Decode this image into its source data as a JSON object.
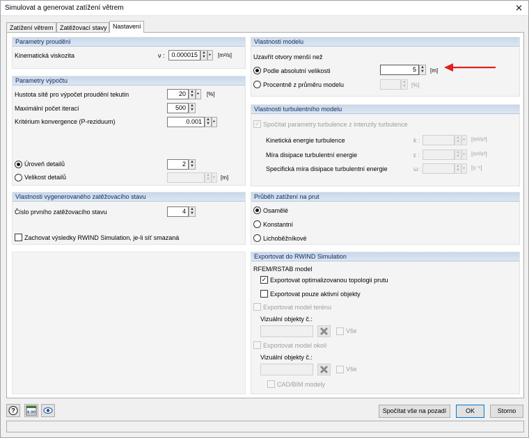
{
  "window": {
    "title": "Simulovat a generovat zatížení větrem",
    "close": "✕"
  },
  "tabs": [
    "Zatížení větrem",
    "Zatěžovací stavy",
    "Nastavení"
  ],
  "flow": {
    "title": "Parametry proudění",
    "viscosity_label": "Kinematická viskozita",
    "viscosity_symbol": "ν :",
    "viscosity_value": "0.000015",
    "viscosity_unit": "[m²/s]"
  },
  "calc": {
    "title": "Parametry výpočtu",
    "mesh_label": "Hustota sítě pro výpočet proudění tekutin",
    "mesh_value": "20",
    "mesh_unit": "[%]",
    "iter_label": "Maximální počet iterací",
    "iter_value": "500",
    "conv_label": "Kritérium konvergence (P-reziduum)",
    "conv_value": "0.001",
    "detail_level_label": "Úroveň detailů",
    "detail_level_value": "2",
    "detail_size_label": "Velikost detailů",
    "detail_size_value": "",
    "detail_size_unit": "[m]"
  },
  "generated": {
    "title": "Vlastnosti vygenerovaného zatěžovacího stavu",
    "first_lc_label": "Číslo prvního zatěžovacího stavu",
    "first_lc_value": "4",
    "keep_results_label": "Zachovat výsledky RWIND Simulation, je-li síť smazaná"
  },
  "model": {
    "title": "Vlastnosti modelu",
    "close_openings_label": "Uzavřít otvory menší než",
    "abs_label": "Podle absolutní velikosti",
    "abs_value": "5",
    "abs_unit": "[m]",
    "pct_label": "Procentně z průměru modelu",
    "pct_value": "",
    "pct_unit": "[%]"
  },
  "turbulence": {
    "title": "Vlastnosti turbulentního modelu",
    "calc_label": "Spočítat parametry turbulence z intenzity turbulence",
    "k_label": "Kinetická energie turbulence",
    "k_symbol": "k :",
    "k_unit": "[m²/s²]",
    "eps_label": "Míra disipace turbulentní energie",
    "eps_symbol": "ε :",
    "eps_unit": "[m²/s³]",
    "omega_label": "Specifická míra disipace turbulentní energie",
    "omega_symbol": "ω :",
    "omega_unit": "[s⁻¹]"
  },
  "member_load": {
    "title": "Průběh zatížení na prut",
    "options": [
      "Osamělé",
      "Konstantní",
      "Lichoběžníkové"
    ]
  },
  "export": {
    "title": "Exportovat do RWIND Simulation",
    "rfem_label": "RFEM/RSTAB model",
    "opt_topology_label": "Exportovat optimalizovanou topologii prutu",
    "active_only_label": "Exportovat pouze aktivní objekty",
    "terrain_label": "Exportovat model terénu",
    "visual_label_1": "Vizuální objekty č.:",
    "all_label_1": "Vše",
    "surroundings_label": "Exportovat model okolí",
    "visual_label_2": "Vizuální objekty č.:",
    "all_label_2": "Vše",
    "cad_label": "CAD/BIM modely"
  },
  "footer": {
    "calc_bg_button": "Spočítat vše na pozadí",
    "ok_button": "OK",
    "cancel_button": "Storno",
    "units_icon_text": "6.00"
  },
  "colors": {
    "arrow": "#e02020",
    "accent": "#0078d7"
  }
}
